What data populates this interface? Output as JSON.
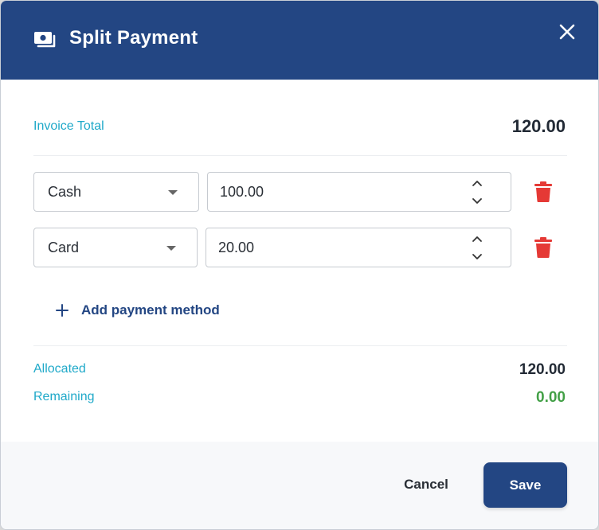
{
  "dialog": {
    "title": "Split Payment",
    "icon": "money-icon",
    "close_icon": "close-icon"
  },
  "invoice": {
    "label": "Invoice Total",
    "value": "120.00"
  },
  "payments": [
    {
      "method": "Cash",
      "amount": "100.00"
    },
    {
      "method": "Card",
      "amount": "20.00"
    }
  ],
  "add_method_label": "Add payment method",
  "summary": {
    "allocated_label": "Allocated",
    "allocated_value": "120.00",
    "remaining_label": "Remaining",
    "remaining_value": "0.00"
  },
  "footer": {
    "cancel_label": "Cancel",
    "save_label": "Save"
  },
  "colors": {
    "header": "#234683",
    "accent_label": "#1fa9c9",
    "delete": "#e53935",
    "remaining_ok": "#43a047"
  }
}
